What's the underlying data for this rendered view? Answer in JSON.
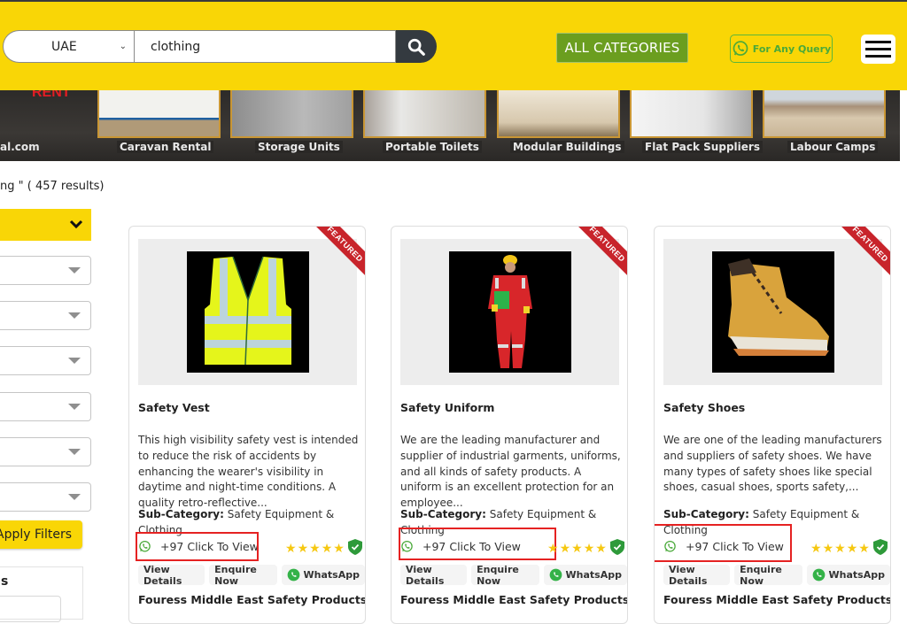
{
  "header": {
    "country_select": {
      "value": "UAE"
    },
    "search": {
      "value": "clothing",
      "placeholder": ""
    },
    "search_button_icon": "search-icon",
    "all_categories_label": "ALL CATEGORIES",
    "query_button_label": "For Any Query",
    "menu_icon": "hamburger-icon"
  },
  "banner": {
    "partial_text_top": "RENT",
    "partial_url": "al.com",
    "captions": [
      "Caravan Rental",
      "Storage Units",
      "Portable Toilets",
      "Modular Buildings",
      "Flat Pack Suppliers",
      "Labour Camps"
    ]
  },
  "results_text": "ng \" ( 457 results)",
  "sidebar": {
    "apply_filters_label": "Apply Filters",
    "partial_heading": "s"
  },
  "colors": {
    "header_yellow": "#f9d606",
    "all_categories_green": "#6b9e1f",
    "whatsapp_green": "#4aa93a",
    "featured_red": "#c8242b",
    "star_yellow": "#f6c812",
    "verified_green": "#2e9a3a",
    "highlight_red": "#e52222"
  },
  "listings": [
    {
      "badge": "FEATURED",
      "title": "Safety Vest",
      "description": "This high visibility safety vest is intended to reduce the risk of accidents by enhancing the wearer's visibility in daytime and night-time conditions. A quality retro-reflective...",
      "subcategory_label": "Sub-Category:",
      "subcategory": "Safety Equipment & Clothing",
      "phone": "+97 Click To View",
      "rating": 5,
      "rating_max": 5,
      "verified": true,
      "actions": {
        "view": "View Details",
        "enquire": "Enquire Now",
        "whatsapp": "WhatsApp"
      },
      "company": "Fouress Middle East Safety Products ..."
    },
    {
      "badge": "FEATURED",
      "title": "Safety Uniform",
      "description": "We are the leading manufacturer and supplier of industrial garments, uniforms, and all kinds of safety products. A uniform is an excellent protection for an employee...",
      "subcategory_label": "Sub-Category:",
      "subcategory": "Safety Equipment & Clothing",
      "phone": "+97 Click To View",
      "rating": 5,
      "rating_max": 5,
      "verified": true,
      "actions": {
        "view": "View Details",
        "enquire": "Enquire Now",
        "whatsapp": "WhatsApp"
      },
      "company": "Fouress Middle East Safety Products ..."
    },
    {
      "badge": "FEATURED",
      "title": "Safety Shoes",
      "description": "We are one of the leading manufacturers and suppliers of safety shoes. We have many types of safety shoes like special shoes, casual shoes, sports safety,...",
      "subcategory_label": "Sub-Category:",
      "subcategory": "Safety Equipment & Clothing",
      "phone": "+97 Click To View",
      "rating": 5,
      "rating_max": 5,
      "verified": true,
      "actions": {
        "view": "View Details",
        "enquire": "Enquire Now",
        "whatsapp": "WhatsApp"
      },
      "company": "Fouress Middle East Safety Products ..."
    }
  ]
}
